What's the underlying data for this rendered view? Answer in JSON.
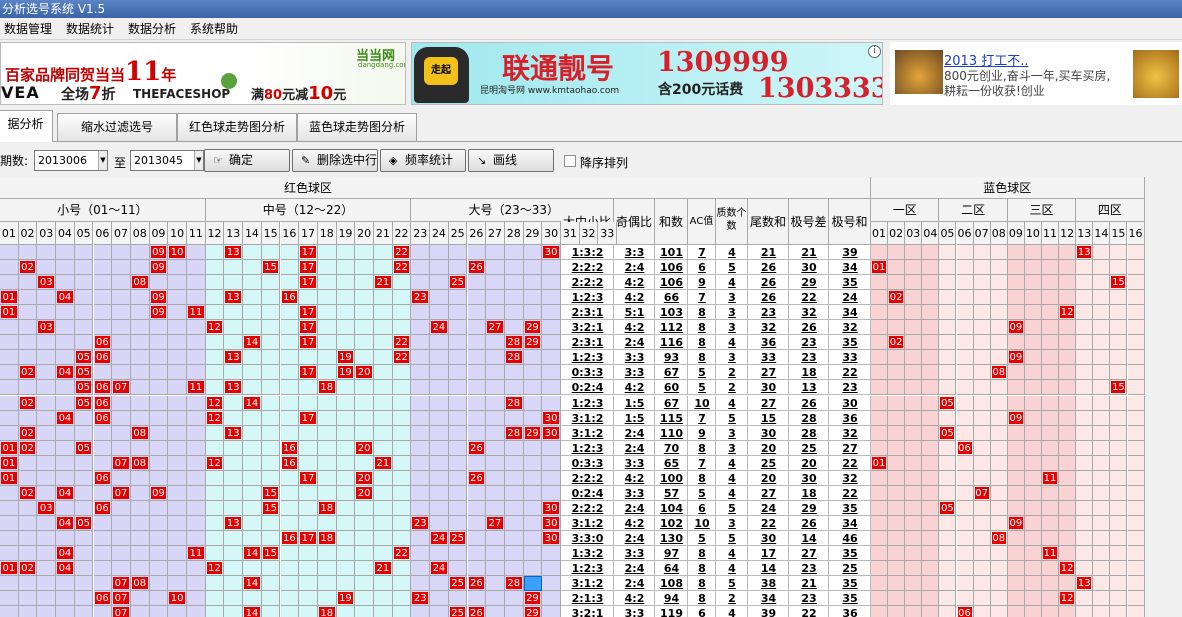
{
  "window": {
    "title": "分析选号系统 V1.5"
  },
  "menu": [
    "数据管理",
    "数据统计",
    "数据分析",
    "系统帮助"
  ],
  "ads": {
    "ad1": {
      "brand": "当当网",
      "brand_sub": "dangdang.com",
      "headline": "百家品牌同贺当当",
      "number": "11",
      "year_char": "年",
      "logo1": "VEA",
      "line2_a": "全场",
      "line2_num": "7",
      "line2_b": "折",
      "logo2": "THEFACESHOP",
      "promo_a": "满",
      "promo_num": "80",
      "promo_b": "元减",
      "promo_num2": "10",
      "promo_c": "元"
    },
    "ad2": {
      "title": "联通靓号",
      "num1": "1309999",
      "num2": "1303333",
      "sub": "昆明淘号网 www.kmtaohao.com",
      "gift": "含200元话费",
      "badge": "走起",
      "info": "i"
    },
    "ad3": {
      "link": "2013 打工不..",
      "text": "800元创业,奋斗一年,买车买房,耕耘一份收获!创业"
    }
  },
  "tabs": [
    "据分析",
    "缩水过滤选号",
    "红色球走势图分析",
    "蓝色球走势图分析"
  ],
  "toolbar": {
    "period_label": "期数:",
    "from": "2013006",
    "to_label": "至",
    "to": "2013045",
    "btn_confirm": "确定",
    "btn_delete": "删除选中行",
    "btn_freq": "频率统计",
    "btn_draw": "画线",
    "desc_label": "降序排列"
  },
  "grid": {
    "red_header": "红色球区",
    "blue_header": "蓝色球区",
    "red_groups": [
      "小号（01～11）",
      "中号（12～22）",
      "大号（23～33）"
    ],
    "metric_headers": [
      "大中小比",
      "奇偶比",
      "和数",
      "AC值",
      "质数个数",
      "尾数和",
      "极号差",
      "极号和"
    ],
    "blue_groups": [
      "一区",
      "二区",
      "三区",
      "四区"
    ],
    "red_cols": [
      "01",
      "02",
      "03",
      "04",
      "05",
      "06",
      "07",
      "08",
      "09",
      "10",
      "11",
      "12",
      "13",
      "14",
      "15",
      "16",
      "17",
      "18",
      "19",
      "20",
      "21",
      "22",
      "23",
      "24",
      "25",
      "26",
      "27",
      "28",
      "29",
      "30",
      "31",
      "32",
      "33"
    ],
    "blue_cols": [
      "01",
      "02",
      "03",
      "04",
      "05",
      "06",
      "07",
      "08",
      "09",
      "10",
      "11",
      "12",
      "13",
      "14",
      "15",
      "16"
    ],
    "rows": [
      {
        "r": [
          9,
          10,
          13,
          17,
          22,
          30
        ],
        "m": [
          "1:3:2",
          "3:3",
          "101",
          "7",
          "4",
          "21",
          "21",
          "39"
        ],
        "b": 13
      },
      {
        "r": [
          2,
          9,
          15,
          17,
          22,
          26,
          32
        ],
        "m": [
          "2:2:2",
          "2:4",
          "106",
          "6",
          "5",
          "26",
          "30",
          "34"
        ],
        "b": 1
      },
      {
        "r": [
          3,
          8,
          17,
          21,
          25,
          32
        ],
        "m": [
          "2:2:2",
          "4:2",
          "106",
          "9",
          "4",
          "26",
          "29",
          "35"
        ],
        "b": 15
      },
      {
        "r": [
          1,
          4,
          9,
          13,
          16,
          23
        ],
        "m": [
          "1:2:3",
          "4:2",
          "66",
          "7",
          "3",
          "26",
          "22",
          "24"
        ],
        "b": 2
      },
      {
        "r": [
          1,
          9,
          11,
          17,
          32,
          33
        ],
        "m": [
          "2:3:1",
          "5:1",
          "103",
          "8",
          "3",
          "23",
          "32",
          "34"
        ],
        "b": 12
      },
      {
        "r": [
          3,
          12,
          17,
          24,
          27,
          29
        ],
        "m": [
          "3:2:1",
          "4:2",
          "112",
          "8",
          "3",
          "32",
          "26",
          "32"
        ],
        "b": 9
      },
      {
        "r": [
          6,
          14,
          17,
          22,
          28,
          29
        ],
        "m": [
          "2:3:1",
          "2:4",
          "116",
          "8",
          "4",
          "36",
          "23",
          "35"
        ],
        "b": 2
      },
      {
        "r": [
          5,
          6,
          13,
          19,
          22,
          28
        ],
        "m": [
          "1:2:3",
          "3:3",
          "93",
          "8",
          "3",
          "33",
          "23",
          "33"
        ],
        "b": 9
      },
      {
        "r": [
          2,
          4,
          5,
          17,
          19,
          20
        ],
        "m": [
          "0:3:3",
          "3:3",
          "67",
          "5",
          "2",
          "27",
          "18",
          "22"
        ],
        "b": 8
      },
      {
        "r": [
          5,
          6,
          7,
          11,
          13,
          18
        ],
        "m": [
          "0:2:4",
          "4:2",
          "60",
          "5",
          "2",
          "30",
          "13",
          "23"
        ],
        "b": 15
      },
      {
        "r": [
          2,
          5,
          6,
          12,
          14,
          28
        ],
        "m": [
          "1:2:3",
          "1:5",
          "67",
          "10",
          "4",
          "27",
          "26",
          "30"
        ],
        "b": 5
      },
      {
        "r": [
          4,
          6,
          12,
          17,
          30,
          31,
          32
        ],
        "m": [
          "3:1:2",
          "1:5",
          "115",
          "7",
          "5",
          "15",
          "28",
          "36"
        ],
        "b": 9
      },
      {
        "r": [
          2,
          8,
          13,
          28,
          29,
          30
        ],
        "m": [
          "3:1:2",
          "2:4",
          "110",
          "9",
          "3",
          "30",
          "28",
          "32"
        ],
        "b": 5
      },
      {
        "r": [
          1,
          2,
          5,
          16,
          20,
          26
        ],
        "m": [
          "1:2:3",
          "2:4",
          "70",
          "8",
          "3",
          "20",
          "25",
          "27"
        ],
        "b": 6
      },
      {
        "r": [
          1,
          7,
          8,
          12,
          16,
          21
        ],
        "m": [
          "0:3:3",
          "3:3",
          "65",
          "7",
          "4",
          "25",
          "20",
          "22"
        ],
        "b": 1
      },
      {
        "r": [
          1,
          6,
          17,
          20,
          26,
          31
        ],
        "m": [
          "2:2:2",
          "4:2",
          "100",
          "8",
          "4",
          "20",
          "30",
          "32"
        ],
        "b": 11
      },
      {
        "r": [
          2,
          4,
          7,
          9,
          15,
          20
        ],
        "m": [
          "0:2:4",
          "3:3",
          "57",
          "5",
          "4",
          "27",
          "18",
          "22"
        ],
        "b": 7
      },
      {
        "r": [
          3,
          6,
          15,
          18,
          30,
          32
        ],
        "m": [
          "2:2:2",
          "2:4",
          "104",
          "6",
          "5",
          "24",
          "29",
          "35"
        ],
        "b": 5
      },
      {
        "r": [
          4,
          5,
          13,
          23,
          27,
          30
        ],
        "m": [
          "3:1:2",
          "4:2",
          "102",
          "10",
          "3",
          "22",
          "26",
          "34"
        ],
        "b": 9
      },
      {
        "r": [
          16,
          17,
          18,
          24,
          25,
          30
        ],
        "m": [
          "3:3:0",
          "2:4",
          "130",
          "5",
          "5",
          "30",
          "14",
          "46"
        ],
        "b": 8
      },
      {
        "r": [
          4,
          11,
          14,
          15,
          22,
          31
        ],
        "m": [
          "1:3:2",
          "3:3",
          "97",
          "8",
          "4",
          "17",
          "27",
          "35"
        ],
        "b": 11
      },
      {
        "r": [
          1,
          2,
          4,
          12,
          21,
          24
        ],
        "m": [
          "1:2:3",
          "2:4",
          "64",
          "8",
          "4",
          "14",
          "23",
          "25"
        ],
        "b": 12
      },
      {
        "r": [
          7,
          8,
          14,
          25,
          26,
          28
        ],
        "m": [
          "3:1:2",
          "2:4",
          "108",
          "8",
          "5",
          "38",
          "21",
          "35"
        ],
        "b": 13
      },
      {
        "r": [
          6,
          7,
          10,
          19,
          23,
          29
        ],
        "m": [
          "2:1:3",
          "4:2",
          "94",
          "8",
          "2",
          "34",
          "23",
          "35"
        ],
        "b": 12
      },
      {
        "r": [
          7,
          14,
          18,
          25,
          26,
          29
        ],
        "m": [
          "3:2:1",
          "3:3",
          "119",
          "6",
          "4",
          "39",
          "22",
          "36"
        ],
        "b": 6
      }
    ],
    "highlight_cell": {
      "row": 22,
      "col": 29
    }
  }
}
